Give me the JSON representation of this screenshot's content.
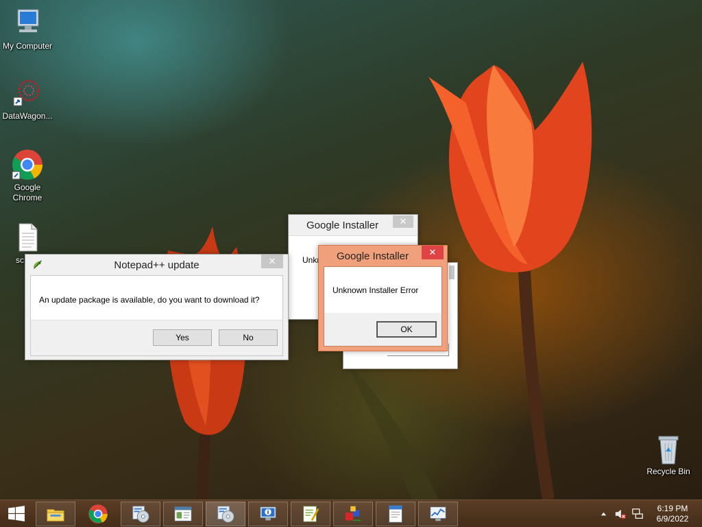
{
  "desktop_icons": [
    {
      "label": "My Computer",
      "icon": "computer-icon"
    },
    {
      "label": "DataWagon...",
      "icon": "datawagon-icon"
    },
    {
      "label": "Google Chrome",
      "icon": "chrome-icon"
    },
    {
      "label": "sc",
      "icon": "document-icon"
    },
    {
      "label": "Recycle Bin",
      "icon": "recycle-bin-icon"
    }
  ],
  "notepad_dialog": {
    "title": "Notepad++ update",
    "message": "An update package is available, do you want to download it?",
    "yes_label": "Yes",
    "no_label": "No",
    "close_glyph": "✕"
  },
  "google_installer_back": {
    "title": "Google Installer",
    "partial_text": "Unkn",
    "close_glyph": "✕"
  },
  "google_installer_front": {
    "title": "Google Installer",
    "message": "Unknown Installer Error",
    "ok_label": "OK",
    "close_glyph": "✕"
  },
  "taskbar": {
    "items": [
      {
        "icon": "start-icon"
      },
      {
        "icon": "file-explorer-icon"
      },
      {
        "icon": "chrome-icon"
      },
      {
        "icon": "installer-cd-icon"
      },
      {
        "icon": "window-app-icon"
      },
      {
        "icon": "installer-cd-icon"
      },
      {
        "icon": "info-monitor-icon"
      },
      {
        "icon": "notepadpp-icon"
      },
      {
        "icon": "blocks-app-icon"
      },
      {
        "icon": "document-app-icon"
      },
      {
        "icon": "performance-monitor-icon"
      }
    ],
    "time": "6:19 PM",
    "date": "6/9/2022",
    "tray_icons": [
      "show-hidden-icons-icon",
      "volume-muted-icon",
      "network-icon"
    ]
  },
  "colors": {
    "taskbar": "#4d331e",
    "active_dialog_border": "#e8956a",
    "active_close": "#e04343"
  }
}
